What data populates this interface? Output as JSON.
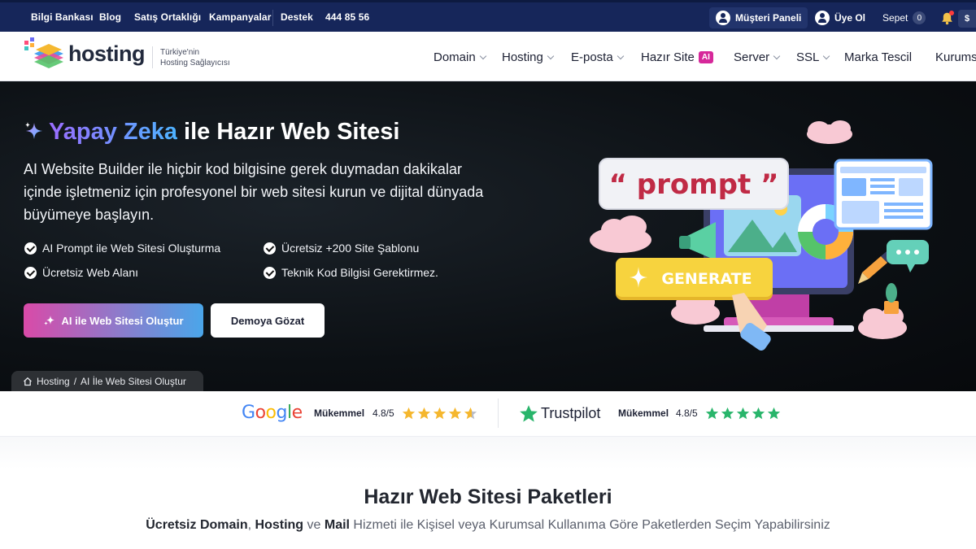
{
  "topbar": {
    "links": [
      "Bilgi Bankası",
      "Blog",
      "Satış Ortaklığı",
      "Kampanyalar"
    ],
    "support_label": "Destek",
    "phone": "444 85 56",
    "customer_panel": "Müşteri Paneli",
    "signup": "Üye Ol",
    "cart_label": "Sepet",
    "cart_count": "0",
    "currency": "$"
  },
  "brand": {
    "name": "hosting",
    "tagline_line1": "Türkiye'nin",
    "tagline_line2": "Hosting Sağlayıcısı"
  },
  "nav": {
    "items": [
      "Domain",
      "Hosting",
      "E-posta",
      "Hazır Site",
      "Server",
      "SSL",
      "Marka Tescil",
      "Kurums"
    ],
    "ai_badge": "AI"
  },
  "hero": {
    "title_highlight": "Yapay Zeka",
    "title_rest": " ile Hazır Web Sitesi",
    "description": "AI Website Builder ile hiçbir kod bilgisine gerek duymadan dakikalar içinde işletmeniz için profesyonel bir web sitesi kurun ve dijital dünyada büyümeye başlayın.",
    "features": [
      "AI Prompt ile Web Sitesi Oluşturma",
      "Ücretsiz +200 Site Şablonu",
      "Ücretsiz Web Alanı",
      "Teknik Kod Bilgisi Gerektirmez."
    ],
    "cta_primary": "AI ile Web Sitesi Oluştur",
    "cta_secondary": "Demoya Gözat",
    "illustration_prompt": "“ prompt ”",
    "illustration_generate": "GENERATE"
  },
  "breadcrumb": {
    "home": "Hosting",
    "separator": "/",
    "current": "AI İle Web Sitesi Oluştur"
  },
  "ratings": {
    "google": {
      "brand": "Google",
      "label": "Mükemmel",
      "score": "4.8/5",
      "stars": 4.8
    },
    "trustpilot": {
      "brand": "Trustpilot",
      "label": "Mükemmel",
      "score": "4.8/5",
      "stars": 5
    }
  },
  "packages": {
    "title": "Hazır Web Sitesi Paketleri",
    "subtitle_b1": "Ücretsiz Domain",
    "subtitle_s1": ", ",
    "subtitle_b2": "Hosting",
    "subtitle_s2": " ve ",
    "subtitle_b3": "Mail",
    "subtitle_rest": " Hizmeti ile Kişisel veya Kurumsal Kullanıma Göre Paketlerden Seçim Yapabilirsiniz"
  },
  "colors": {
    "topbar_bg": "#16265a",
    "ai_badge": "#d6289a",
    "cta_gradient_start": "#d94aa8",
    "cta_gradient_end": "#4aa6ea",
    "google_star": "#f5b72e",
    "trustpilot_star": "#29b56b"
  }
}
